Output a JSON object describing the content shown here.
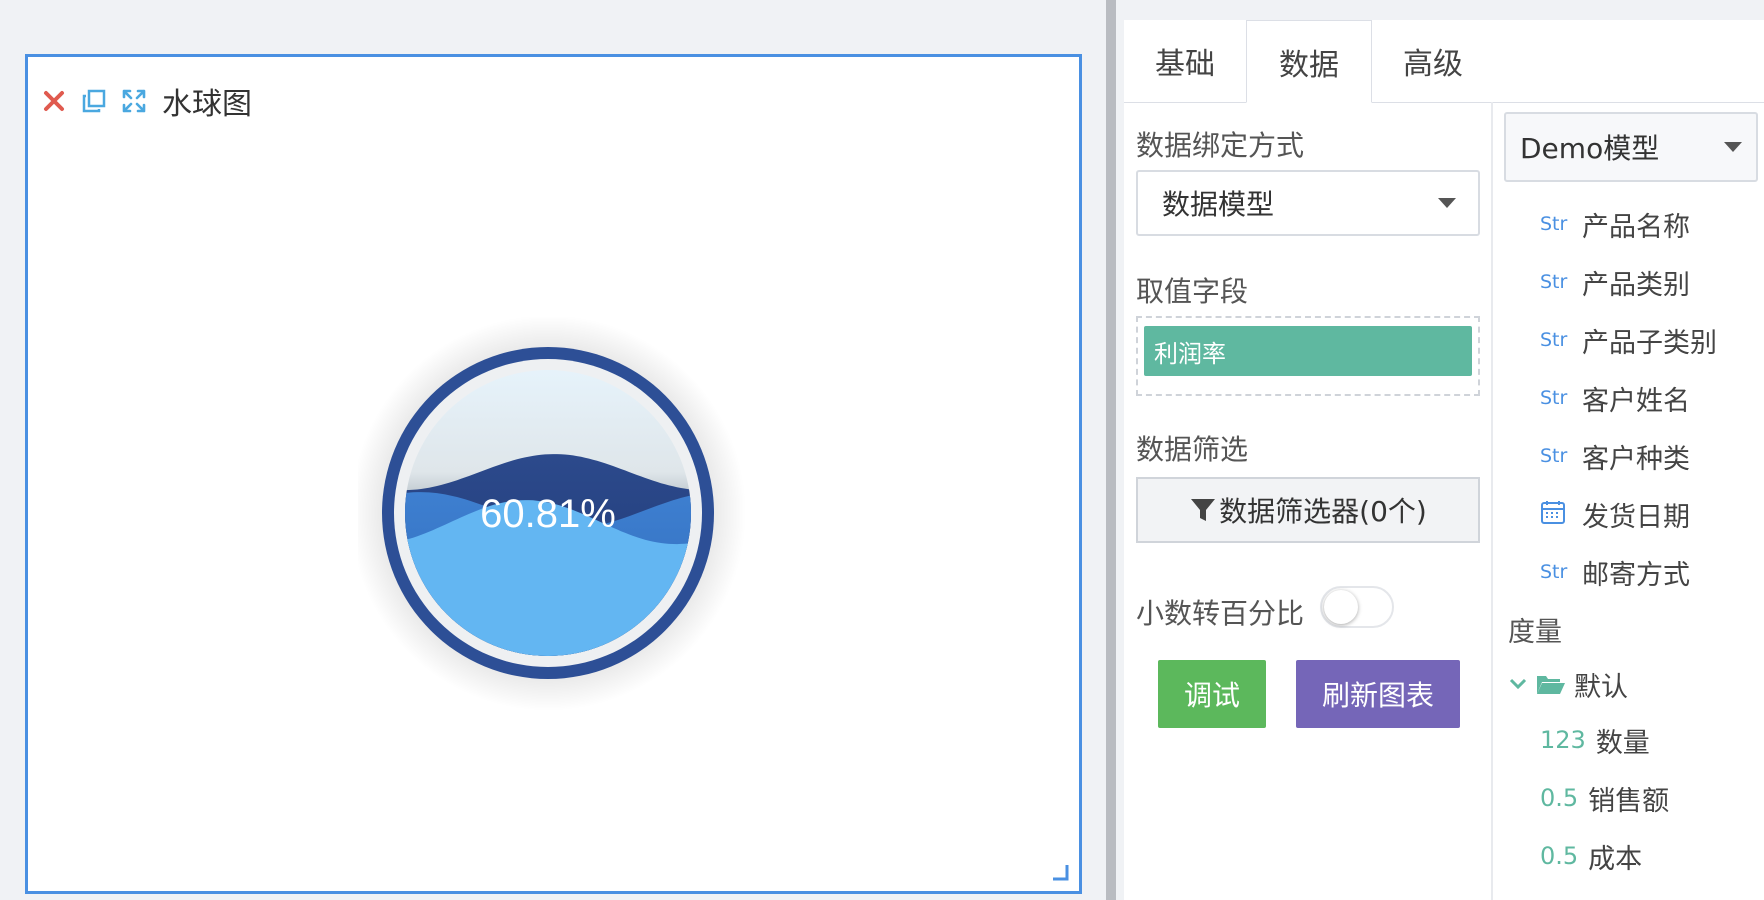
{
  "widget": {
    "title": "水球图",
    "value_text": "60.81%",
    "value": 0.6081
  },
  "tabs": [
    "基础",
    "数据",
    "高级"
  ],
  "active_tab": "数据",
  "data_panel": {
    "binding_label": "数据绑定方式",
    "binding_value": "数据模型",
    "value_field_label": "取值字段",
    "value_field_chip": "利润率",
    "filter_label": "数据筛选",
    "filter_button": "数据筛选器(0个)",
    "percent_toggle_label": "小数转百分比",
    "percent_toggle_on": false,
    "debug_button": "调试",
    "refresh_button": "刷新图表"
  },
  "model_panel": {
    "model_select": "Demo模型",
    "dimensions": [
      {
        "type": "Str",
        "name": "产品名称"
      },
      {
        "type": "Str",
        "name": "产品类别"
      },
      {
        "type": "Str",
        "name": "产品子类别"
      },
      {
        "type": "Str",
        "name": "客户姓名"
      },
      {
        "type": "Str",
        "name": "客户种类"
      },
      {
        "type": "date",
        "name": "发货日期"
      },
      {
        "type": "Str",
        "name": "邮寄方式"
      }
    ],
    "measures_label": "度量",
    "measure_folder": "默认",
    "measures": [
      {
        "type": "123",
        "name": "数量"
      },
      {
        "type": "0.5",
        "name": "销售额"
      },
      {
        "type": "0.5",
        "name": "成本"
      }
    ]
  },
  "colors": {
    "accent_border": "#4a90e2",
    "ring": "#2d4f96",
    "wave_light": "#63b6f2",
    "wave_dark": "#233f7e",
    "chip": "#5fb8a0",
    "debug_btn": "#5cb85c",
    "refresh_btn": "#7566b8",
    "close_icon": "#e05a4f"
  }
}
